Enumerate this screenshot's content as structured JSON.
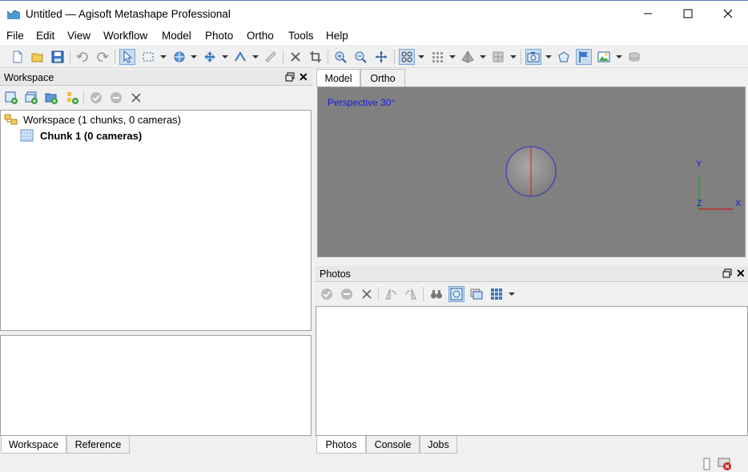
{
  "window": {
    "title": "Untitled — Agisoft Metashape Professional",
    "controls": [
      "minimize-icon",
      "maximize-icon",
      "close-icon"
    ]
  },
  "menu": [
    "File",
    "Edit",
    "View",
    "Workflow",
    "Model",
    "Photo",
    "Ortho",
    "Tools",
    "Help"
  ],
  "toolbar": {
    "icons": [
      "new-document-icon",
      "open-folder-icon",
      "save-icon",
      "undo-icon",
      "redo-icon",
      "select-pointer-icon",
      "rectangle-selection-icon",
      "navigation-icon",
      "move-object-icon",
      "draw-polyline-icon",
      "ruler-icon",
      "delete-selection-icon",
      "crop-icon",
      "zoom-in-icon",
      "zoom-out-icon",
      "reset-view-icon",
      "point-cloud-icon",
      "dense-cloud-icon",
      "model-shaded-icon",
      "tiled-model-icon",
      "show-cameras-icon",
      "show-shapes-icon",
      "show-markers-icon",
      "show-images-icon",
      "show-region-icon"
    ]
  },
  "workspace": {
    "title": "Workspace",
    "toolbar_icons": [
      "add-chunk-icon",
      "add-photos-icon",
      "add-folder-icon",
      "add-markers-icon",
      "enable-icon",
      "disable-icon",
      "remove-icon"
    ],
    "tree": {
      "root": "Workspace (1 chunks, 0 cameras)",
      "chunk": "Chunk 1 (0 cameras)"
    },
    "bottom_tabs": [
      "Workspace",
      "Reference"
    ]
  },
  "model_view": {
    "tabs": [
      "Model",
      "Ortho"
    ],
    "perspective_label": "Perspective 30°",
    "axes": {
      "y": "Y",
      "z": "Z",
      "x": "X"
    },
    "colors": {
      "background": "#808080",
      "label": "#1a1adc",
      "axis_y": "#00b000",
      "axis_x": "#e00000",
      "axis_z": "#0000e0"
    }
  },
  "photos": {
    "title": "Photos",
    "toolbar_icons": [
      "enable-icon",
      "disable-icon",
      "remove-icon",
      "rotate-left-icon",
      "rotate-right-icon",
      "filter-icon",
      "reset-filter-icon",
      "show-info-icon",
      "view-mode-icon"
    ],
    "bottom_tabs": [
      "Photos",
      "Console",
      "Jobs"
    ]
  },
  "status": {
    "icons": [
      "status-document-icon",
      "status-error-icon"
    ]
  }
}
